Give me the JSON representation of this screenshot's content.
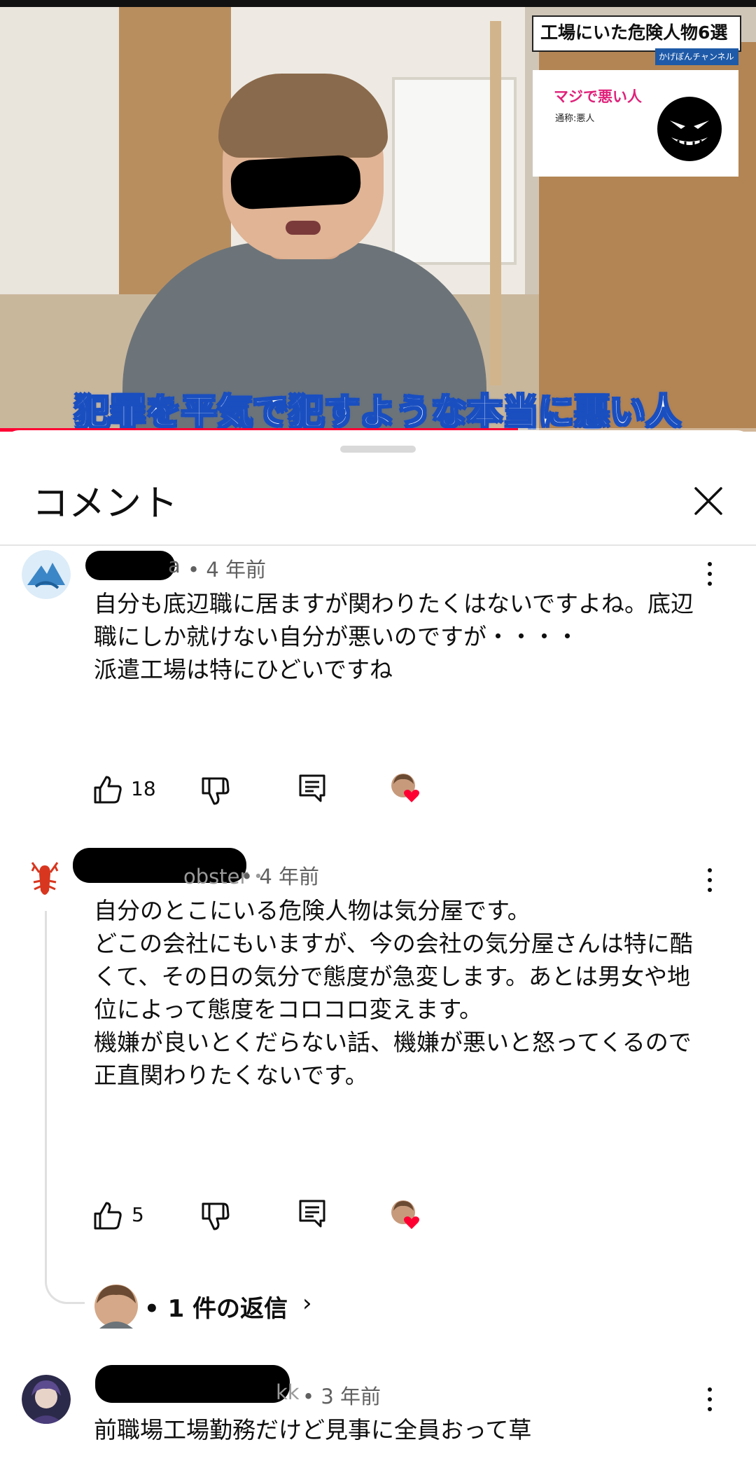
{
  "video": {
    "title_overlay": "工場にいた危険人物6選",
    "channel_overlay": "かげぽんチャンネル",
    "card_title": "マジで悪い人",
    "card_subtitle": "通称:悪人",
    "subtitle": "犯罪を平気で犯すような本当に悪い人",
    "progress_fraction": 0.685,
    "progress_color": "#ff0033"
  },
  "sheet": {
    "title": "コメント",
    "close_icon": "close-icon"
  },
  "comments": [
    {
      "author_visible": "a",
      "time": "• 4 年前",
      "text": "自分も底辺職に居ますが関わりたくはないですよね。底辺職にしか就けない自分が悪いのですが・・・・\n派遣工場は特にひどいですね",
      "likes": "18",
      "creator_heart": true
    },
    {
      "author_visible": "obster・",
      "time": "• 4 年前",
      "text": "自分のとこにいる危険人物は気分屋です。\nどこの会社にもいますが、今の会社の気分屋さんは特に酷くて、その日の気分で態度が急変します。あとは男女や地位によって態度をコロコロ変えます。\n機嫌が良いとくだらない話、機嫌が悪いと怒ってくるので正直関わりたくないです。",
      "likes": "5",
      "creator_heart": true,
      "replies_label": "• 1 件の返信",
      "replies_chevron": "›"
    },
    {
      "author_visible": "kk",
      "time": "• 3 年前",
      "text": "前職場工場勤務だけど見事に全員おって草"
    }
  ],
  "icons": {
    "like": "thumbs-up-icon",
    "dislike": "thumbs-down-icon",
    "reply": "reply-icon",
    "more": "more-vertical-icon",
    "heart_color": "#ff0033"
  }
}
